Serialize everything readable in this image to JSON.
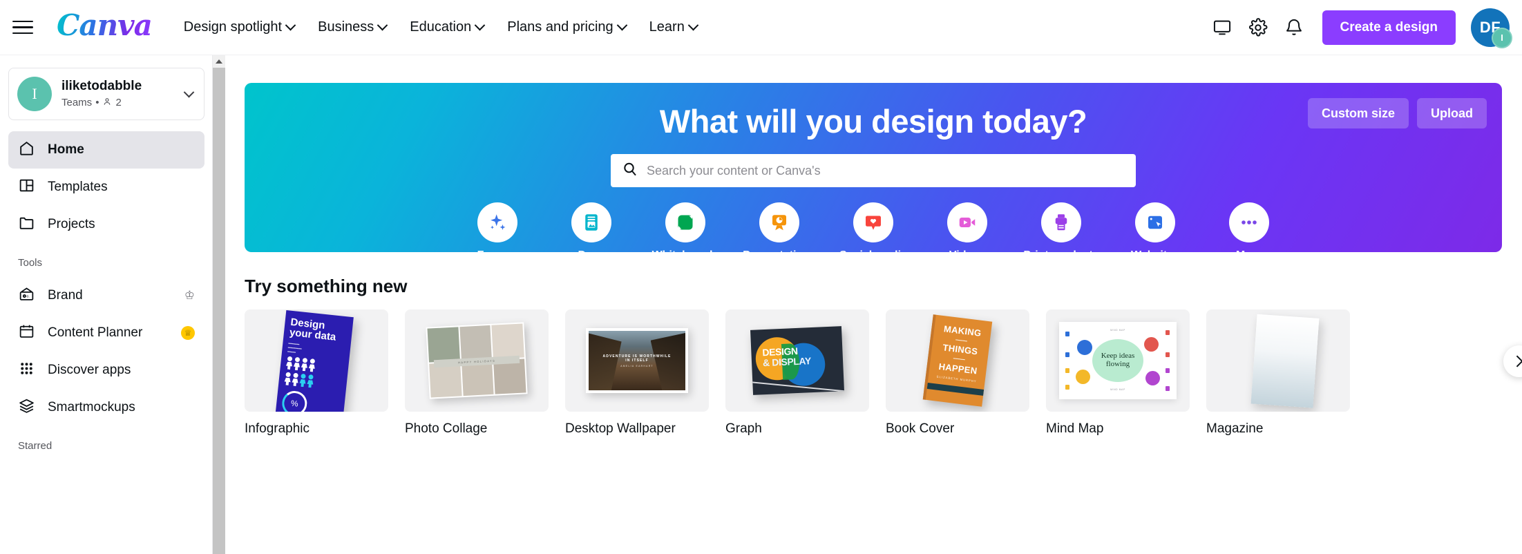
{
  "header": {
    "menu_icon": "hamburger-icon",
    "logo_text": "Canva",
    "nav": [
      {
        "label": "Design spotlight",
        "has_chevron": true
      },
      {
        "label": "Business",
        "has_chevron": true
      },
      {
        "label": "Education",
        "has_chevron": true
      },
      {
        "label": "Plans and pricing",
        "has_chevron": true
      },
      {
        "label": "Learn",
        "has_chevron": true
      }
    ],
    "icons": [
      {
        "name": "display-icon"
      },
      {
        "name": "gear-icon"
      },
      {
        "name": "bell-icon"
      }
    ],
    "create_button": "Create a design",
    "avatar_initials": "DF",
    "avatar_badge_initial": "I",
    "avatar_color": "#1273ba",
    "avatar_badge_color": "#5bc2ae",
    "create_button_color": "#8B3DFF"
  },
  "sidebar": {
    "team": {
      "avatar_initial": "I",
      "name": "iliketodabble",
      "subtitle_prefix": "Teams",
      "separator": "•",
      "member_count": "2"
    },
    "items": [
      {
        "label": "Home",
        "icon": "home-icon",
        "active": true
      },
      {
        "label": "Templates",
        "icon": "templates-icon",
        "active": false
      },
      {
        "label": "Projects",
        "icon": "folder-icon",
        "active": false
      }
    ],
    "tools_label": "Tools",
    "tools": [
      {
        "label": "Brand",
        "icon": "brand-icon",
        "badge": "crown"
      },
      {
        "label": "Content Planner",
        "icon": "calendar-icon",
        "badge": "pro-dot"
      },
      {
        "label": "Discover apps",
        "icon": "grid-apps-icon",
        "badge": ""
      },
      {
        "label": "Smartmockups",
        "icon": "layers-icon",
        "badge": ""
      }
    ],
    "starred_label": "Starred"
  },
  "hero": {
    "title": "What will you design today?",
    "search_placeholder": "Search your content or Canva's",
    "search_value": "",
    "search_icon": "search-icon",
    "custom_size_label": "Custom size",
    "upload_label": "Upload",
    "gradient_start": "#00c4cc",
    "gradient_end": "#7d2ae8",
    "categories": [
      {
        "label": "For you",
        "icon": "sparkles-icon",
        "color": "#3b74e8",
        "selected": false
      },
      {
        "label": "Docs",
        "icon": "doc-icon",
        "color": "#00b5cc",
        "selected": false
      },
      {
        "label": "Whiteboards",
        "icon": "whiteboard-icon",
        "color": "#00a651",
        "selected": false
      },
      {
        "label": "Presentations",
        "icon": "presentation-icon",
        "color": "#f5940a",
        "selected": false
      },
      {
        "label": "Social media",
        "icon": "heart-bubble-icon",
        "color": "#f8443c",
        "selected": false
      },
      {
        "label": "Videos",
        "icon": "video-icon",
        "color": "#e45cd8",
        "selected": false
      },
      {
        "label": "Print products",
        "icon": "print-icon",
        "color": "#9b3fe8",
        "selected": false
      },
      {
        "label": "Websites",
        "icon": "website-cursor-icon",
        "color": "#2c6fe6",
        "selected": false
      },
      {
        "label": "More",
        "icon": "ellipsis-icon",
        "color": "#ffffff",
        "selected": true
      }
    ]
  },
  "try_new": {
    "title": "Try something new",
    "next_label": "Next",
    "cards": [
      {
        "name": "Infographic",
        "art": "infographic",
        "art_text": {
          "line1": "Design",
          "line2": "your data",
          "percent": "%"
        }
      },
      {
        "name": "Photo Collage",
        "art": "collage",
        "art_text": {
          "band": "HAPPY HOLIDAYS"
        }
      },
      {
        "name": "Desktop Wallpaper",
        "art": "wallpaper",
        "art_text": {
          "line1": "ADVENTURE IS WORTHWHILE",
          "line2": "IN ITSELF",
          "line3": "AMELIA EARHART"
        }
      },
      {
        "name": "Graph",
        "art": "graph",
        "art_text": {
          "line1": "DESIGN",
          "line2": "& DISPLAY"
        }
      },
      {
        "name": "Book Cover",
        "art": "book",
        "art_text": {
          "line1": "MAKING",
          "line2": "THINGS",
          "line3": "HAPPEN",
          "author": "ELIZABETH MURPHY"
        }
      },
      {
        "name": "Mind Map",
        "art": "mindmap",
        "art_text": {
          "center1": "Keep ideas",
          "center2": "flowing",
          "top": "MIND MAP",
          "bottom": "MIND MAP"
        }
      },
      {
        "name": "Magazine",
        "art": "magazine",
        "art_text": {}
      }
    ]
  }
}
